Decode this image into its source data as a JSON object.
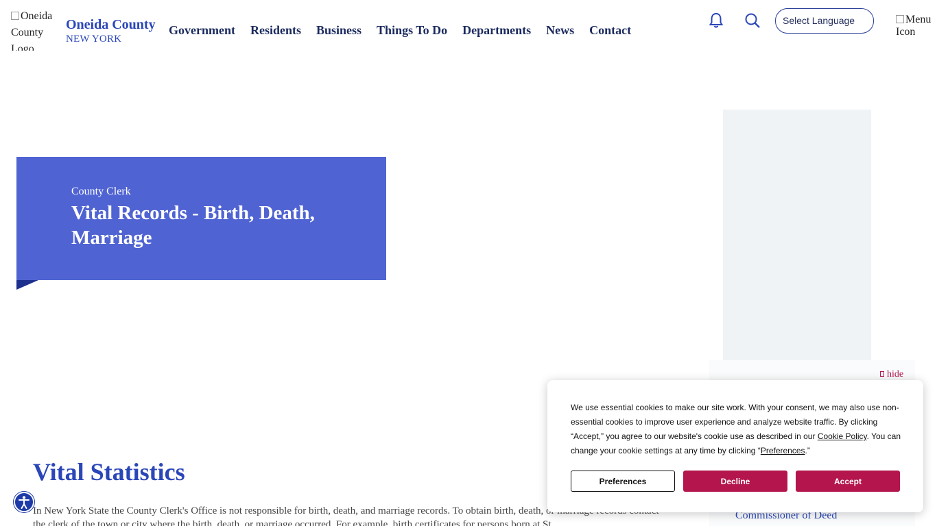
{
  "header": {
    "logo_alt": "Oneida County Logo",
    "brand_name": "Oneida County",
    "brand_sub": "NEW YORK",
    "nav": [
      "Government",
      "Residents",
      "Business",
      "Things To Do",
      "Departments",
      "News",
      "Contact"
    ],
    "language_select": "Select Language",
    "menu_alt": "Menu Icon"
  },
  "hero": {
    "kicker": "County Clerk",
    "title": "Vital Records - Birth, Death, Marriage"
  },
  "main": {
    "heading": "Vital Statistics",
    "paragraph": "In New York State the County Clerk's Office is not responsible for birth, death, and marriage records.  To obtain birth, death, or marriage records contact the clerk of the town or city where the birth, death, or marriage occurred.  For example, birth certificates for persons born at St..."
  },
  "sidebar": {
    "hide_label": "hide",
    "link": "Commissioner of Deed"
  },
  "cookie": {
    "text_1": "We use essential cookies to make our site work. With your consent, we may also use non-essential cookies to improve user experience and analyze website traffic. By clicking “Accept,” you agree to our website's cookie use as described in our ",
    "policy_link": "Cookie Policy",
    "text_2": ". You can change your cookie settings at any time by clicking “",
    "pref_link": "Preferences",
    "text_3": ".”",
    "btn_preferences": "Preferences",
    "btn_decline": "Decline",
    "btn_accept": "Accept"
  },
  "colors": {
    "brand_blue": "#2a46b8",
    "hero_blue": "#4f63d2",
    "accent_crimson": "#b3154c"
  }
}
